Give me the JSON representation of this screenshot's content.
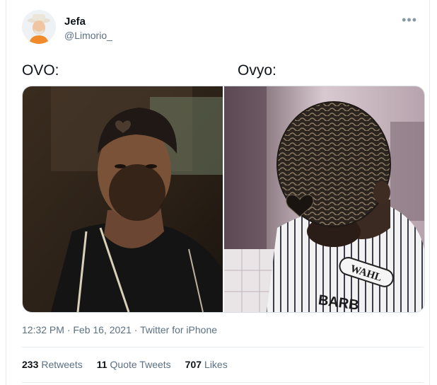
{
  "tweet": {
    "display_name": "Jefa",
    "handle": "@Limorio_",
    "more_icon": "more-horizontal-icon",
    "text_left": "OVO:",
    "text_right": "Ovyo:",
    "timestamp": "12:32 PM · Feb 16, 2021",
    "separator": "·",
    "source": "Twitter for iPhone",
    "stats": {
      "retweets_count": "233",
      "retweets_label": "Retweets",
      "quotes_count": "11",
      "quotes_label": "Quote Tweets",
      "likes_count": "707",
      "likes_label": "Likes"
    },
    "images": {
      "right_shirt_text_1": "WAHL",
      "right_shirt_text_2": "BARB"
    }
  }
}
